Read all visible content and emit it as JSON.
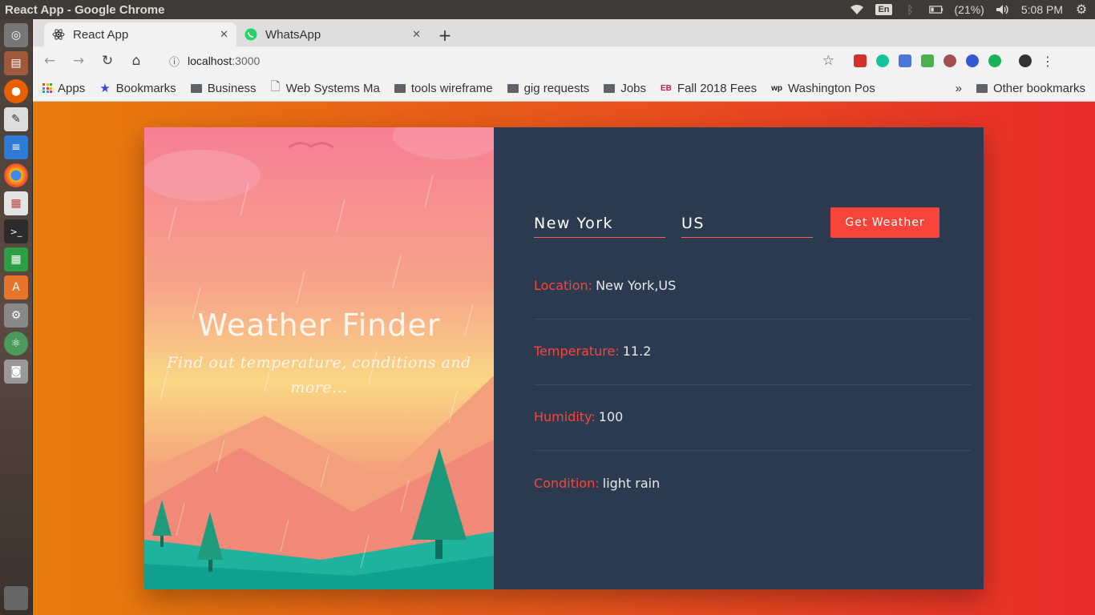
{
  "os": {
    "window_title": "React App - Google Chrome",
    "language": "En",
    "battery": "(21%)",
    "clock": "5:08 PM"
  },
  "browser": {
    "tabs": [
      {
        "title": "React App",
        "icon": "react-icon",
        "active": true
      },
      {
        "title": "WhatsApp",
        "icon": "whatsapp-icon",
        "active": false
      }
    ],
    "url_host": "localhost",
    "url_port": ":3000",
    "bookmarks": [
      {
        "label": "Apps",
        "icon": "apps-grid-icon"
      },
      {
        "label": "Bookmarks",
        "icon": "star-icon"
      },
      {
        "label": "Business",
        "icon": "folder-icon"
      },
      {
        "label": "Web Systems Ma",
        "icon": "page-icon"
      },
      {
        "label": "tools wireframe",
        "icon": "folder-icon"
      },
      {
        "label": "gig requests",
        "icon": "folder-icon"
      },
      {
        "label": "Jobs",
        "icon": "folder-icon"
      },
      {
        "label": "Fall 2018 Fees",
        "icon": "eb-icon"
      },
      {
        "label": "Washington Pos",
        "icon": "wp-icon"
      }
    ],
    "overflow": "»",
    "other_bookmarks": "Other bookmarks"
  },
  "app": {
    "title": "Weather Finder",
    "subtitle": "Find out temperature, conditions and more...",
    "city_value": "New York",
    "country_value": "US",
    "button_label": "Get Weather",
    "results": [
      {
        "key": "Location:",
        "value": "New York,US"
      },
      {
        "key": "Temperature:",
        "value": "11.2"
      },
      {
        "key": "Humidity:",
        "value": "100"
      },
      {
        "key": "Condition:",
        "value": "light rain"
      }
    ]
  },
  "colors": {
    "accent": "#f5453b",
    "panel": "#2c3a4f"
  }
}
